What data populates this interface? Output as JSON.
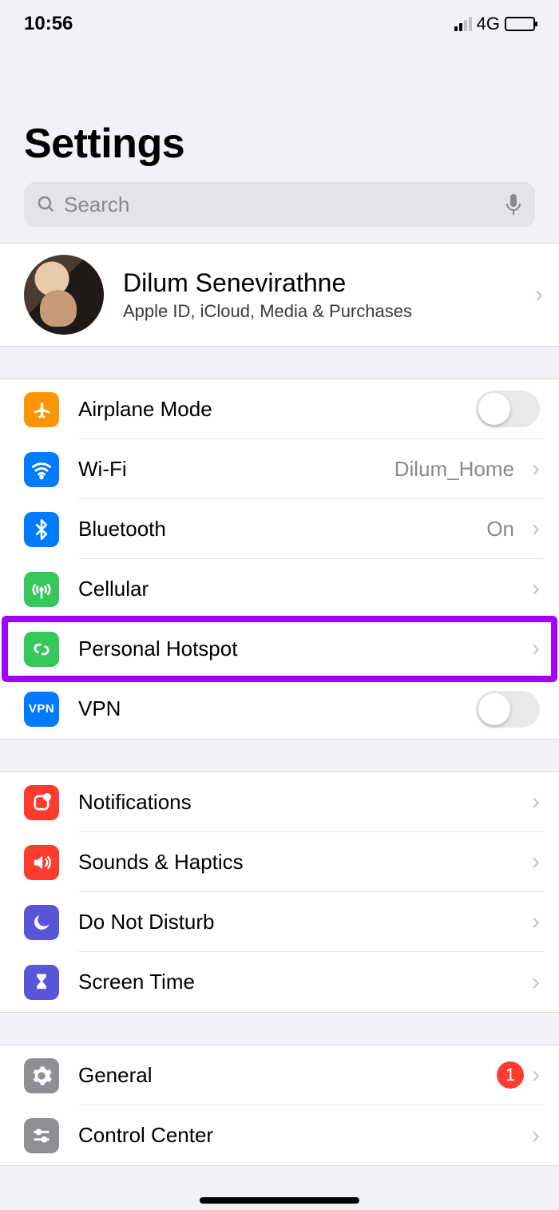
{
  "status": {
    "time": "10:56",
    "network": "4G"
  },
  "page": {
    "title": "Settings"
  },
  "search": {
    "placeholder": "Search"
  },
  "profile": {
    "name": "Dilum Senevirathne",
    "subtitle": "Apple ID, iCloud, Media & Purchases"
  },
  "group1": {
    "airplane": "Airplane Mode",
    "wifi": "Wi-Fi",
    "wifi_detail": "Dilum_Home",
    "bluetooth": "Bluetooth",
    "bluetooth_detail": "On",
    "cellular": "Cellular",
    "hotspot": "Personal Hotspot",
    "vpn": "VPN"
  },
  "group2": {
    "notifications": "Notifications",
    "sounds": "Sounds & Haptics",
    "dnd": "Do Not Disturb",
    "screentime": "Screen Time"
  },
  "group3": {
    "general": "General",
    "general_badge": "1",
    "control": "Control Center"
  }
}
